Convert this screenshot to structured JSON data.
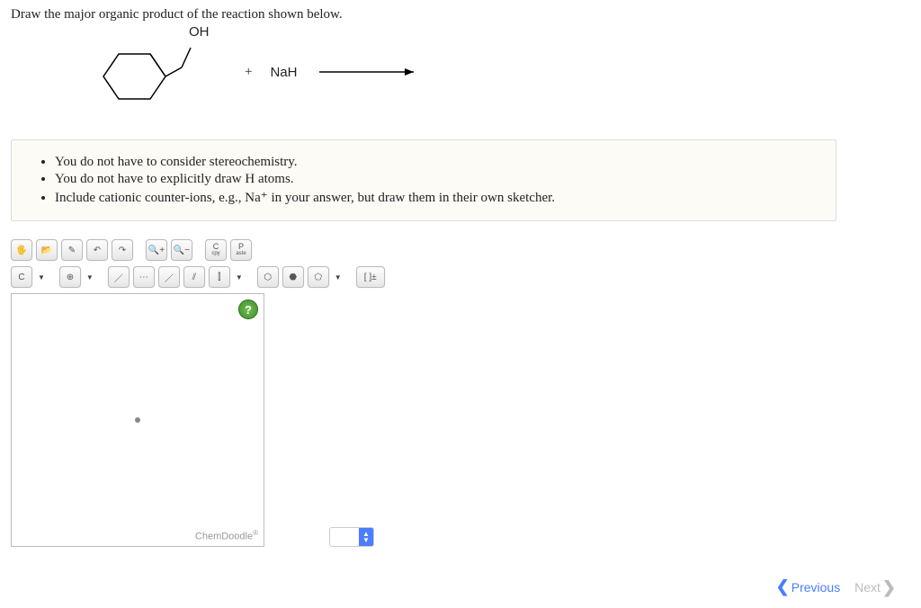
{
  "question": "Draw the major organic product of the reaction shown below.",
  "reaction": {
    "substituent_label": "OH",
    "plus": "+",
    "reagent": "NaH"
  },
  "instructions": [
    "You do not have to consider stereochemistry.",
    "You do not have to explicitly draw H atoms.",
    "Include cationic counter-ions, e.g., Na⁺ in your answer, but draw them in their own sketcher."
  ],
  "toolbar1": {
    "hand": "✋",
    "lock": "🔒",
    "pencil": "✎",
    "undo": "↶",
    "redo": "↷",
    "zoomin": "+",
    "zoomout": "−",
    "copy_label": "C",
    "copy_sub": "cpy",
    "paste_label": "P",
    "paste_sub": "aste"
  },
  "toolbar2": {
    "carbon": "C",
    "charge": "⊕",
    "bond1": "／",
    "bond_dash": "⋯",
    "bond_wedge": "／",
    "bond_hash": "⫽",
    "bond_wavy": "⫿",
    "hex": "⬡",
    "hex2": "⬣",
    "pent": "⬠",
    "brackets": "[ ]±"
  },
  "canvas": {
    "help": "?",
    "brand": "ChemDoodle",
    "brand_reg": "®"
  },
  "stepper_value": "",
  "nav": {
    "previous": "Previous",
    "next": "Next"
  }
}
